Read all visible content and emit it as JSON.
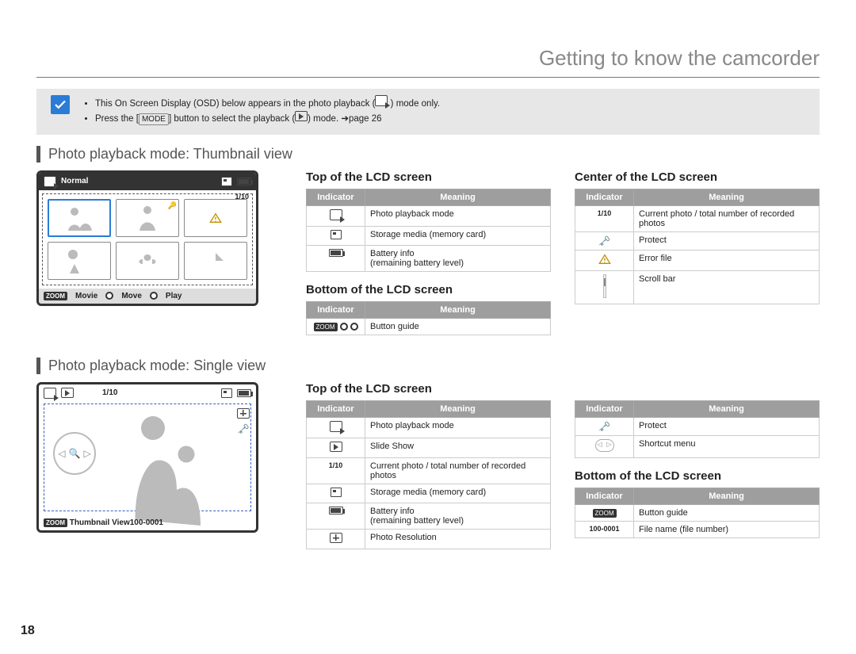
{
  "header": {
    "title": "Getting to know the camcorder"
  },
  "note": {
    "line1_a": "This On Screen Display (OSD) below appears in the photo playback (",
    "line1_b": " ) mode only.",
    "line2_a": "Press the [",
    "line2_mode": "MODE",
    "line2_b": "] button to select the playback (",
    "line2_c": ") mode. ",
    "line2_page": "page 26"
  },
  "sec1": {
    "heading": "Photo playback mode: Thumbnail view",
    "screen": {
      "top_label": "Normal",
      "count": "1/10",
      "foot_zoom": "ZOOM",
      "foot_movie": "Movie",
      "foot_move": "Move",
      "foot_play": "Play"
    },
    "top": {
      "title": "Top of the LCD screen",
      "th1": "Indicator",
      "th2": "Meaning",
      "r1": "Photo playback mode",
      "r2": "Storage media (memory card)",
      "r3a": "Battery info",
      "r3b": "(remaining battery level)"
    },
    "bottom": {
      "title": "Bottom of the LCD screen",
      "th1": "Indicator",
      "th2": "Meaning",
      "r1": "Button guide"
    },
    "center": {
      "title": "Center of the LCD screen",
      "th1": "Indicator",
      "th2": "Meaning",
      "c0": "1/10",
      "r0": "Current photo / total number of recorded photos",
      "r1": "Protect",
      "r2": "Error file",
      "r3": "Scroll bar"
    }
  },
  "sec2": {
    "heading": "Photo playback mode: Single view",
    "screen": {
      "count": "1/10",
      "foot_zoom": "ZOOM",
      "foot_label": "Thumbnail View",
      "file": "100-0001"
    },
    "topL": {
      "title": "Top of the LCD screen",
      "th1": "Indicator",
      "th2": "Meaning",
      "r1": "Photo playback mode",
      "r2": "Slide Show",
      "c3": "1/10",
      "r3": "Current photo / total number of recorded photos",
      "r4": "Storage media (memory card)",
      "r5a": "Battery info",
      "r5b": "(remaining battery level)",
      "r6": "Photo Resolution"
    },
    "topR": {
      "th1": "Indicator",
      "th2": "Meaning",
      "r1": "Protect",
      "r2": "Shortcut menu"
    },
    "bottom": {
      "title": "Bottom of the LCD screen",
      "th1": "Indicator",
      "th2": "Meaning",
      "r1": "Button guide",
      "c2": "100-0001",
      "r2": "File name (file number)"
    }
  },
  "page_number": "18"
}
